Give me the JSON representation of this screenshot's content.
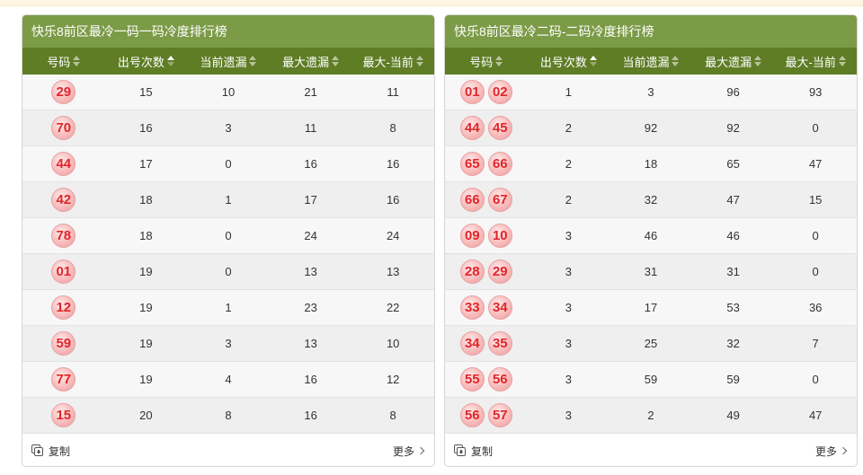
{
  "panels": [
    {
      "title": "快乐8前区最冷一码一码冷度排行榜",
      "columns": [
        "号码",
        "出号次数",
        "当前遗漏",
        "最大遗漏",
        "最大-当前"
      ],
      "active_sort": 1,
      "rows": [
        {
          "balls": [
            "29"
          ],
          "count": "15",
          "current": "10",
          "max": "21",
          "diff": "11"
        },
        {
          "balls": [
            "70"
          ],
          "count": "16",
          "current": "3",
          "max": "11",
          "diff": "8"
        },
        {
          "balls": [
            "44"
          ],
          "count": "17",
          "current": "0",
          "max": "16",
          "diff": "16"
        },
        {
          "balls": [
            "42"
          ],
          "count": "18",
          "current": "1",
          "max": "17",
          "diff": "16"
        },
        {
          "balls": [
            "78"
          ],
          "count": "18",
          "current": "0",
          "max": "24",
          "diff": "24"
        },
        {
          "balls": [
            "01"
          ],
          "count": "19",
          "current": "0",
          "max": "13",
          "diff": "13"
        },
        {
          "balls": [
            "12"
          ],
          "count": "19",
          "current": "1",
          "max": "23",
          "diff": "22"
        },
        {
          "balls": [
            "59"
          ],
          "count": "19",
          "current": "3",
          "max": "13",
          "diff": "10"
        },
        {
          "balls": [
            "77"
          ],
          "count": "19",
          "current": "4",
          "max": "16",
          "diff": "12"
        },
        {
          "balls": [
            "15"
          ],
          "count": "20",
          "current": "8",
          "max": "16",
          "diff": "8"
        }
      ],
      "copy_label": "复制",
      "more_label": "更多"
    },
    {
      "title": "快乐8前区最冷二码-二码冷度排行榜",
      "columns": [
        "号码",
        "出号次数",
        "当前遗漏",
        "最大遗漏",
        "最大-当前"
      ],
      "active_sort": 1,
      "rows": [
        {
          "balls": [
            "01",
            "02"
          ],
          "count": "1",
          "current": "3",
          "max": "96",
          "diff": "93"
        },
        {
          "balls": [
            "44",
            "45"
          ],
          "count": "2",
          "current": "92",
          "max": "92",
          "diff": "0"
        },
        {
          "balls": [
            "65",
            "66"
          ],
          "count": "2",
          "current": "18",
          "max": "65",
          "diff": "47"
        },
        {
          "balls": [
            "66",
            "67"
          ],
          "count": "2",
          "current": "32",
          "max": "47",
          "diff": "15"
        },
        {
          "balls": [
            "09",
            "10"
          ],
          "count": "3",
          "current": "46",
          "max": "46",
          "diff": "0"
        },
        {
          "balls": [
            "28",
            "29"
          ],
          "count": "3",
          "current": "31",
          "max": "31",
          "diff": "0"
        },
        {
          "balls": [
            "33",
            "34"
          ],
          "count": "3",
          "current": "17",
          "max": "53",
          "diff": "36"
        },
        {
          "balls": [
            "34",
            "35"
          ],
          "count": "3",
          "current": "25",
          "max": "32",
          "diff": "7"
        },
        {
          "balls": [
            "55",
            "56"
          ],
          "count": "3",
          "current": "59",
          "max": "59",
          "diff": "0"
        },
        {
          "balls": [
            "56",
            "57"
          ],
          "count": "3",
          "current": "2",
          "max": "49",
          "diff": "47"
        }
      ],
      "copy_label": "复制",
      "more_label": "更多"
    }
  ],
  "colors": {
    "title_bg": "#7c9b47",
    "header_bg": "#5e7d25",
    "ball_text": "#e0262a"
  }
}
